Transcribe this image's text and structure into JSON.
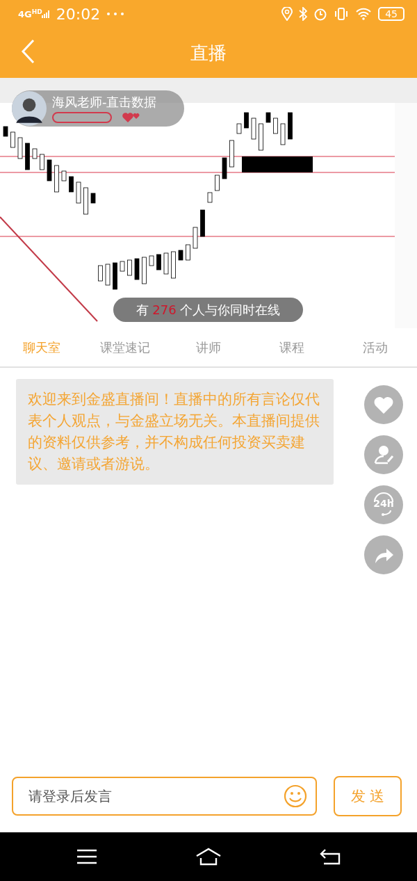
{
  "status_bar": {
    "network": "4G",
    "network_badge": "HD",
    "time": "20:02",
    "battery": "45"
  },
  "header": {
    "title": "直播"
  },
  "video": {
    "kind": "picture",
    "host": {
      "name": "海风老师-直击数据"
    },
    "online": {
      "prefix": "有",
      "count": "276",
      "suffix": "个人与你同时在线"
    }
  },
  "tabs": [
    {
      "label": "聊天室",
      "selected": true
    },
    {
      "label": "课堂速记",
      "selected": false
    },
    {
      "label": "讲师",
      "selected": false
    },
    {
      "label": "课程",
      "selected": false
    },
    {
      "label": "活动",
      "selected": false
    }
  ],
  "messages": [
    {
      "text": "欢迎来到金盛直播间！直播中的所有言论仅代表个人观点，与金盛立场无关。本直播间提供的资料仅供参考，并不构成任何投资买卖建议、邀请或者游说。"
    }
  ],
  "side_actions": [
    {
      "kind": "like"
    },
    {
      "kind": "profile"
    },
    {
      "kind": "service",
      "badge": "24h"
    },
    {
      "kind": "share"
    }
  ],
  "composer": {
    "placeholder": "请登录后发言",
    "send": "发 送"
  }
}
